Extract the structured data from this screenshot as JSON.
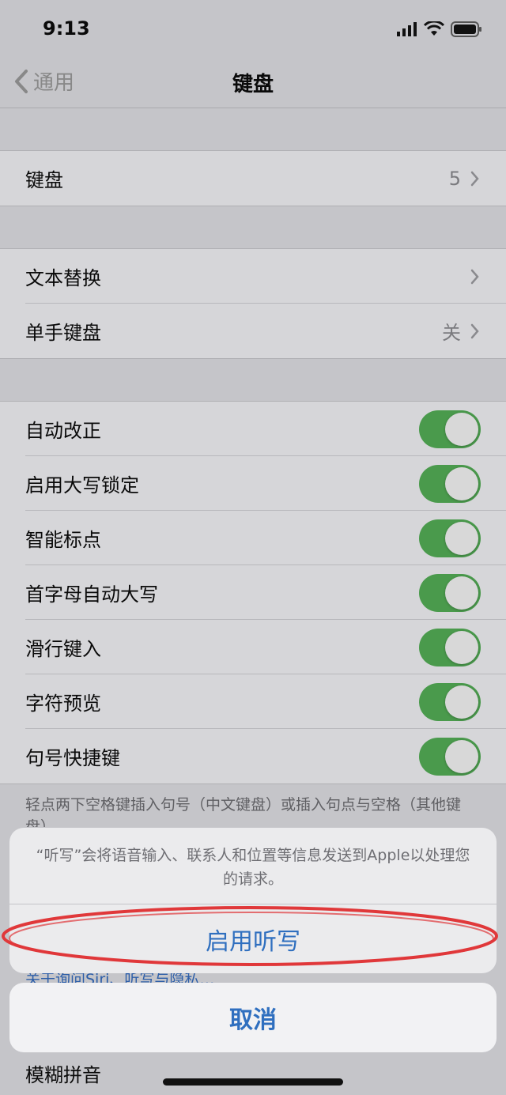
{
  "status_bar": {
    "time": "9:13"
  },
  "nav": {
    "back_label": "通用",
    "title": "键盘"
  },
  "group1": {
    "keyboards": {
      "label": "键盘",
      "value": "5"
    }
  },
  "group2": {
    "text_replacement": {
      "label": "文本替换"
    },
    "one_handed": {
      "label": "单手键盘",
      "value": "关"
    }
  },
  "toggles": [
    {
      "label": "自动改正",
      "on": true
    },
    {
      "label": "启用大写锁定",
      "on": true
    },
    {
      "label": "智能标点",
      "on": true
    },
    {
      "label": "首字母自动大写",
      "on": true
    },
    {
      "label": "滑行键入",
      "on": true
    },
    {
      "label": "字符预览",
      "on": true
    },
    {
      "label": "句号快捷键",
      "on": true
    }
  ],
  "footnote": "轻点两下空格键插入句号（中文键盘）或插入句点与空格（其他键盘）。",
  "partially_hidden": {
    "link": "关于询问Siri、听写与隐私…",
    "fuzzy_pinyin": "模糊拼音"
  },
  "sheet": {
    "message": "“听写”会将语音输入、联系人和位置等信息发送到Apple以处理您的请求。",
    "enable_label": "启用听写",
    "cancel_label": "取消"
  },
  "colors": {
    "toggle_on": "#4a9a4c",
    "action_blue": "#2f6fbf",
    "annotation_red": "#e0383a"
  }
}
